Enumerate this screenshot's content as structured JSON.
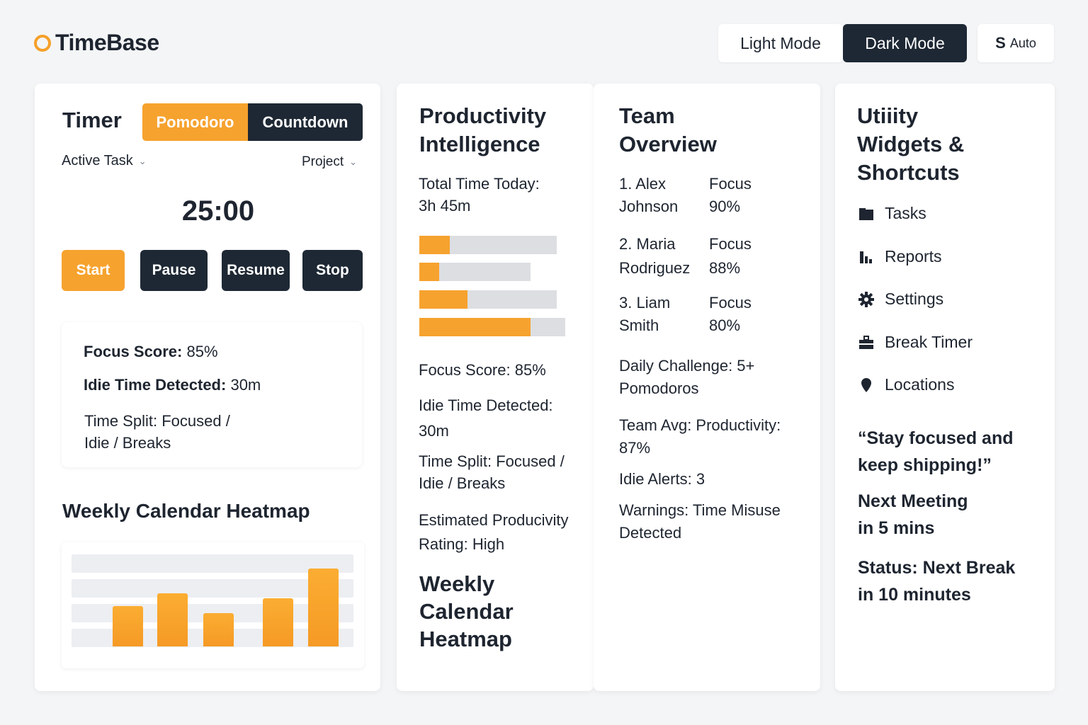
{
  "app": {
    "name": "TimeBase"
  },
  "mode": {
    "light": "Light Mode",
    "dark": "Dark Mode",
    "auto_s": "S",
    "auto": "Auto"
  },
  "timer": {
    "title": "Timer",
    "modes": [
      "Pomodoro",
      "Countdown"
    ],
    "active_task": "Active Task",
    "project": "Project",
    "clock": "25:00",
    "buttons": {
      "start": "Start",
      "pause": "Pause",
      "resume": "Resume",
      "stop": "Stop"
    },
    "focus_label": "Focus Score:",
    "focus_value": "85%",
    "idle_label": "Idie Time Detected:",
    "idle_value": "30m",
    "split_1": "Time Split: Focused /",
    "split_2": "Idie / Breaks",
    "heatmap_title": "Weekly Calendar Heatmap",
    "heatmap_values": [
      0.52,
      0.68,
      0.43,
      0.62,
      1.0
    ]
  },
  "productivity": {
    "title_1": "Productivity",
    "title_2": "Intelligence",
    "total_1": "Total Time Today:",
    "total_2": "3h 45m",
    "bars": [
      {
        "track": 1.0,
        "fill": 0.22
      },
      {
        "track": 0.81,
        "fill": 0.18
      },
      {
        "track": 1.0,
        "fill": 0.35
      },
      {
        "track": 1.06,
        "fill": 0.76
      }
    ],
    "focus": "Focus Score: 85%",
    "idle_1": "Idie Time Detected:",
    "idle_2": "30m",
    "split_1": "Time Split: Focused /",
    "split_2": "Idie / Breaks",
    "rating_1": "Estimated Producivity",
    "rating_2": "Rating: High",
    "heat_1": "Weekly",
    "heat_2": "Calendar",
    "heat_3": "Heatmap"
  },
  "team": {
    "title_1": "Team",
    "title_2": "Overview",
    "members": [
      {
        "line1": "1. Alex",
        "line2": "Johnson",
        "focus": "Focus",
        "pct": "90%"
      },
      {
        "line1": "2. Maria",
        "line2": "Rodriguez",
        "focus": "Focus",
        "pct": "88%"
      },
      {
        "line1": "3. Liam",
        "line2": "Smith",
        "focus": "Focus",
        "pct": "80%"
      }
    ],
    "challenge_1": "Daily Challenge: 5+",
    "challenge_2": "Pomodoros",
    "avg_1": "Team Avg: Productivity:",
    "avg_2": "87%",
    "alerts": "Idie Alerts: 3",
    "warn_1": "Warnings: Time Misuse",
    "warn_2": "Detected"
  },
  "utility": {
    "title_1": "Utiiity",
    "title_2": "Widgets &",
    "title_3": "Shortcuts",
    "items": [
      {
        "label": "Tasks",
        "icon": "folder-icon"
      },
      {
        "label": "Reports",
        "icon": "bar-chart-icon"
      },
      {
        "label": "Settings",
        "icon": "gear-icon"
      },
      {
        "label": "Break Timer",
        "icon": "briefcase-icon"
      },
      {
        "label": "Locations",
        "icon": "map-pin-icon"
      }
    ],
    "quote_1": "“Stay focused and",
    "quote_2": "keep shipping!”",
    "meeting_1": "Next Meeting",
    "meeting_2": "in 5 mins",
    "status_1": "Status: Next Break",
    "status_2": "in 10 minutes"
  },
  "colors": {
    "accent": "#f6a22e",
    "dark": "#1e2834",
    "bg": "#f4f5f7"
  }
}
